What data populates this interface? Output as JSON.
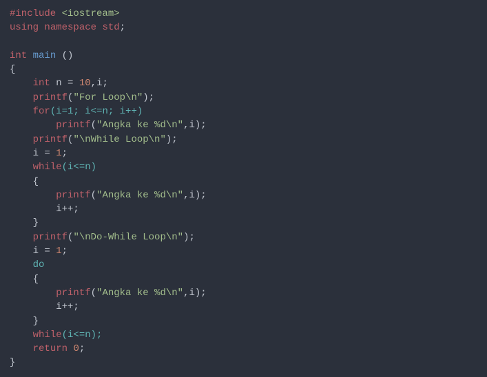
{
  "code": {
    "t_include": "#include",
    "t_iostream": "<iostream>",
    "t_using": "using",
    "t_namespace": "namespace",
    "t_std": "std",
    "t_int": "int",
    "t_main": "main",
    "t_parens_empty": "()",
    "t_lbrace": "{",
    "t_rbrace": "}",
    "t_n": "n",
    "t_eq": "=",
    "t_10": "10",
    "t_comma_i": ",i;",
    "t_printf": "printf",
    "t_lparen": "(",
    "t_rparen_semi": ");",
    "t_rparen": ")",
    "t_str_forloop": "\"For Loop\\n\"",
    "t_for": "for",
    "t_for_args": "(i=1; i<=n; i++)",
    "t_str_angka": "\"Angka ke %d\\n\"",
    "t_comma_i_paren": ",i);",
    "t_str_whileloop": "\"\\nWhile Loop\\n\"",
    "t_i": "i",
    "t_1": "1",
    "t_semi": ";",
    "t_while": "while",
    "t_cond": "(i<=n)",
    "t_ipp": "i++;",
    "t_str_dowhile": "\"\\nDo-While Loop\\n\"",
    "t_do": "do",
    "t_cond_semi": "(i<=n);",
    "t_return": "return",
    "t_0": "0"
  }
}
